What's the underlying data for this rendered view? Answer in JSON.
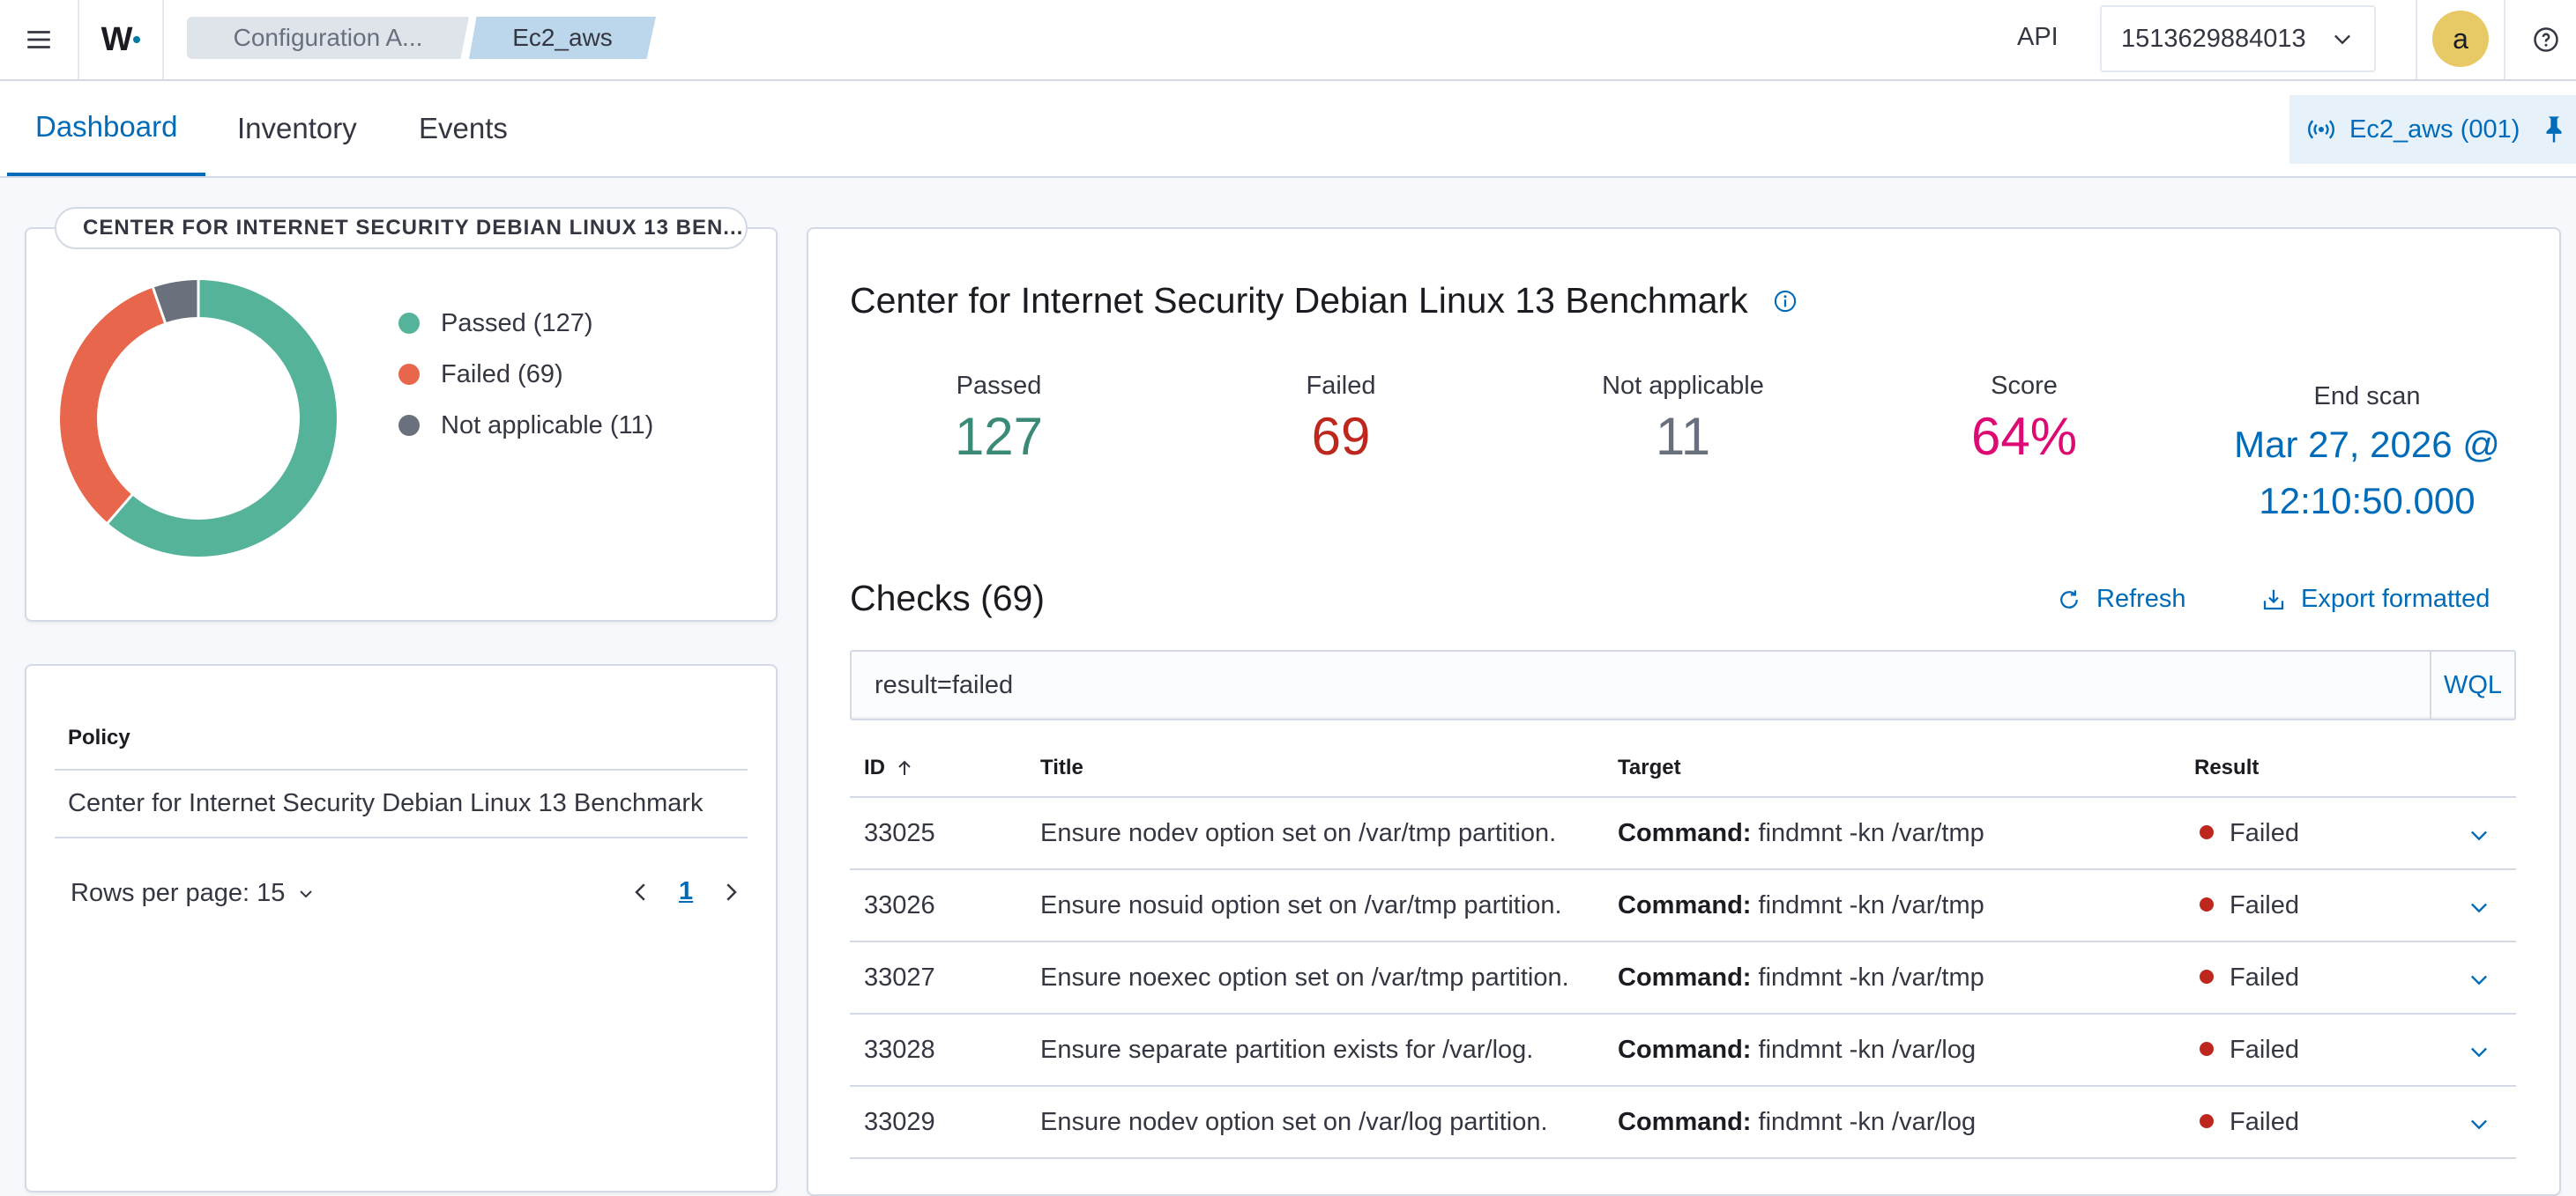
{
  "header": {
    "logo_text": "W",
    "breadcrumb": [
      "Configuration A...",
      "Ec2_aws"
    ],
    "api_label": "API",
    "selector_value": "1513629884013",
    "avatar_letter": "a"
  },
  "tabs": [
    "Dashboard",
    "Inventory",
    "Events"
  ],
  "active_tab": "Dashboard",
  "agent_pill": "Ec2_aws (001)",
  "summary_panel": {
    "title": "CENTER FOR INTERNET SECURITY DEBIAN LINUX 13 BEN...",
    "legend": [
      {
        "label": "Passed (127)",
        "color": "#54b399"
      },
      {
        "label": "Failed (69)",
        "color": "#e7664c"
      },
      {
        "label": "Not applicable (11)",
        "color": "#6a717d"
      }
    ]
  },
  "chart_data": {
    "type": "pie",
    "categories": [
      "Passed",
      "Failed",
      "Not applicable"
    ],
    "values": [
      127,
      69,
      11
    ],
    "colors": [
      "#54b399",
      "#e7664c",
      "#6a717d"
    ],
    "donut": true
  },
  "policy_table": {
    "header": "Policy",
    "rows": [
      "Center for Internet Security Debian Linux 13 Benchmark"
    ],
    "rows_per_page": "Rows per page: 15",
    "page": "1"
  },
  "benchmark": {
    "title": "Center for Internet Security Debian Linux 13 Benchmark",
    "stats": [
      {
        "label": "Passed",
        "value": "127",
        "color": "#3b8a78"
      },
      {
        "label": "Failed",
        "value": "69",
        "color": "#bd271e"
      },
      {
        "label": "Not applicable",
        "value": "11",
        "color": "#69707d"
      },
      {
        "label": "Score",
        "value": "64%",
        "color": "#dd0a73"
      }
    ],
    "end_scan_label": "End scan",
    "end_scan_line1": "Mar 27, 2026 @",
    "end_scan_line2": "12:10:50.000"
  },
  "checks": {
    "title": "Checks (69)",
    "refresh_label": "Refresh",
    "export_label": "Export formatted",
    "query": "result=failed",
    "wql_label": "WQL",
    "columns": [
      "ID",
      "Title",
      "Target",
      "Result"
    ],
    "rows": [
      {
        "id": "33025",
        "title": "Ensure nodev option set on /var/tmp partition.",
        "target_key": "Command:",
        "target_val": "findmnt -kn /var/tmp",
        "result": "Failed"
      },
      {
        "id": "33026",
        "title": "Ensure nosuid option set on /var/tmp partition.",
        "target_key": "Command:",
        "target_val": "findmnt -kn /var/tmp",
        "result": "Failed"
      },
      {
        "id": "33027",
        "title": "Ensure noexec option set on /var/tmp partition.",
        "target_key": "Command:",
        "target_val": "findmnt -kn /var/tmp",
        "result": "Failed"
      },
      {
        "id": "33028",
        "title": "Ensure separate partition exists for /var/log.",
        "target_key": "Command:",
        "target_val": "findmnt -kn /var/log",
        "result": "Failed"
      },
      {
        "id": "33029",
        "title": "Ensure nodev option set on /var/log partition.",
        "target_key": "Command:",
        "target_val": "findmnt -kn /var/log",
        "result": "Failed"
      }
    ]
  }
}
